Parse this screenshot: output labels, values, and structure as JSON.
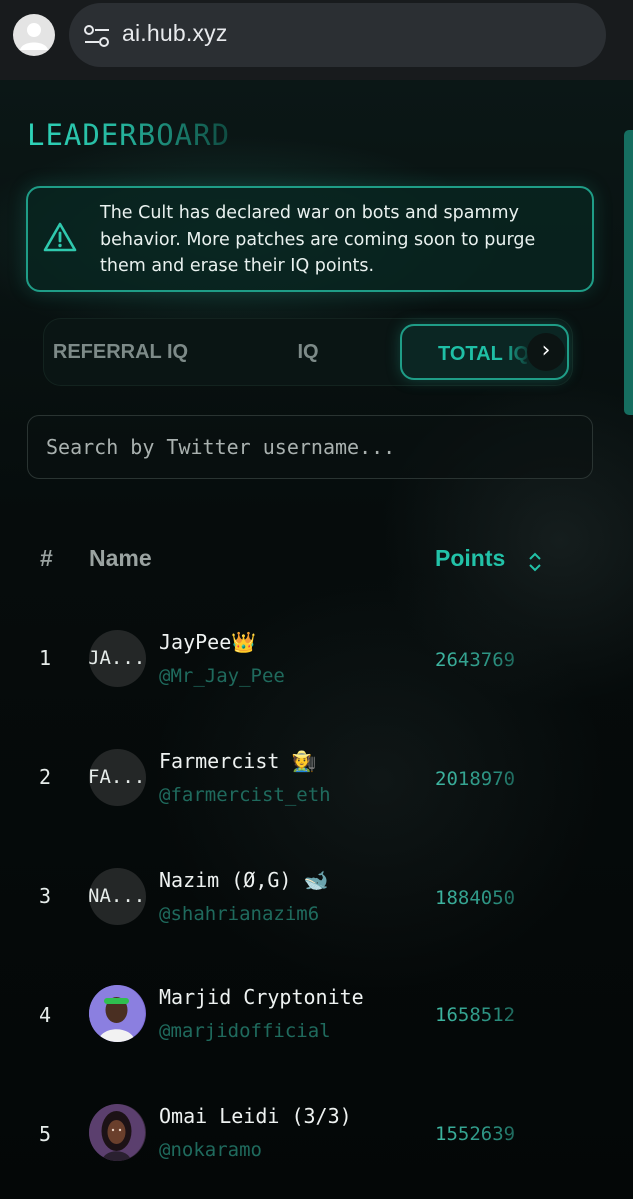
{
  "browser": {
    "url": "ai.hub.xyz"
  },
  "page": {
    "title": "LEADERBOARD",
    "alert_text": "The Cult has declared war on bots and spammy behavior. More patches are coming soon to purge them and erase their IQ points."
  },
  "tabs": {
    "referral_label": "REFERRAL IQ",
    "iq_label": "IQ",
    "total_label": "TOTAL IQ",
    "active": "TOTAL IQ"
  },
  "search": {
    "placeholder": "Search by Twitter username..."
  },
  "table": {
    "headers": {
      "rank": "#",
      "name": "Name",
      "points": "Points"
    },
    "rows": [
      {
        "rank": "1",
        "avatar_text": "JA...",
        "name": "JayPee👑",
        "handle": "@Mr_Jay_Pee",
        "points": "2643769"
      },
      {
        "rank": "2",
        "avatar_text": "FA...",
        "name": "Farmercist 🧑‍🌾",
        "handle": "@farmercist_eth",
        "points": "2018970"
      },
      {
        "rank": "3",
        "avatar_text": "NA...",
        "name": "Nazim (Ø,G) 🐋",
        "handle": "@shahrianazim6",
        "points": "1884050"
      },
      {
        "rank": "4",
        "avatar_text": "",
        "name": "Marjid Cryptonite",
        "handle": "@marjidofficial",
        "points": "1658512"
      },
      {
        "rank": "5",
        "avatar_text": "",
        "name": "Omai Leidi (3/3)",
        "handle": "@nokaramo",
        "points": "1552639"
      }
    ]
  },
  "icons": {
    "account": "account-icon",
    "site_settings": "tune-icon",
    "alert": "warning-triangle-icon",
    "tabs_next": "chevron-right-icon",
    "sort": "sort-icon"
  },
  "colors": {
    "accent": "#22c2a8",
    "background": "#050a0a",
    "handle": "#1f6a5d"
  }
}
